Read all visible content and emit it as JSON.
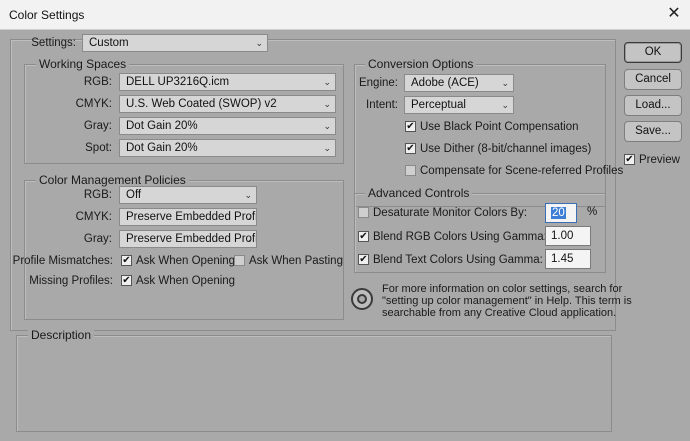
{
  "window": {
    "title": "Color Settings",
    "close_glyph": "✕"
  },
  "settings": {
    "label": "Settings:",
    "value": "Custom"
  },
  "working_spaces": {
    "legend": "Working Spaces",
    "rgb": {
      "label": "RGB:",
      "value": "DELL UP3216Q.icm"
    },
    "cmyk": {
      "label": "CMYK:",
      "value": "U.S. Web Coated (SWOP) v2"
    },
    "gray": {
      "label": "Gray:",
      "value": "Dot Gain 20%"
    },
    "spot": {
      "label": "Spot:",
      "value": "Dot Gain 20%"
    }
  },
  "policies": {
    "legend": "Color Management Policies",
    "rgb": {
      "label": "RGB:",
      "value": "Off"
    },
    "cmyk": {
      "label": "CMYK:",
      "value": "Preserve Embedded Profiles"
    },
    "gray": {
      "label": "Gray:",
      "value": "Preserve Embedded Profiles"
    },
    "mismatches": {
      "label": "Profile Mismatches:",
      "ask_opening": "Ask When Opening",
      "ask_opening_checked": true,
      "ask_pasting": "Ask When Pasting",
      "ask_pasting_checked": false
    },
    "missing": {
      "label": "Missing Profiles:",
      "ask_opening": "Ask When Opening",
      "ask_opening_checked": true
    }
  },
  "conversion": {
    "legend": "Conversion Options",
    "engine": {
      "label": "Engine:",
      "value": "Adobe (ACE)"
    },
    "intent": {
      "label": "Intent:",
      "value": "Perceptual"
    },
    "black_point": {
      "label": "Use Black Point Compensation",
      "checked": true
    },
    "dither": {
      "label": "Use Dither (8-bit/channel images)",
      "checked": true
    },
    "scene": {
      "label": "Compensate for Scene-referred Profiles",
      "checked": false
    }
  },
  "advanced": {
    "legend": "Advanced Controls",
    "desaturate": {
      "label": "Desaturate Monitor Colors By:",
      "checked": false,
      "value": "20",
      "unit": "%"
    },
    "blend_rgb": {
      "label": "Blend RGB Colors Using Gamma:",
      "checked": true,
      "value": "1.00"
    },
    "blend_text": {
      "label": "Blend Text Colors Using Gamma:",
      "checked": true,
      "value": "1.45"
    }
  },
  "info": {
    "line1": "For more information on color settings, search for",
    "line2": "\"setting up color management\" in Help. This term is",
    "line3": "searchable from any Creative Cloud application."
  },
  "description": {
    "legend": "Description"
  },
  "buttons": {
    "ok": "OK",
    "cancel": "Cancel",
    "load": "Load...",
    "save": "Save..."
  },
  "preview": {
    "label": "Preview",
    "checked": true
  },
  "glyphs": {
    "chevron": "⌄",
    "check": "✔"
  },
  "colors": {
    "background": "#a9a9a9",
    "titlebar": "#f2f2f2",
    "selection": "#3d7fd6"
  }
}
